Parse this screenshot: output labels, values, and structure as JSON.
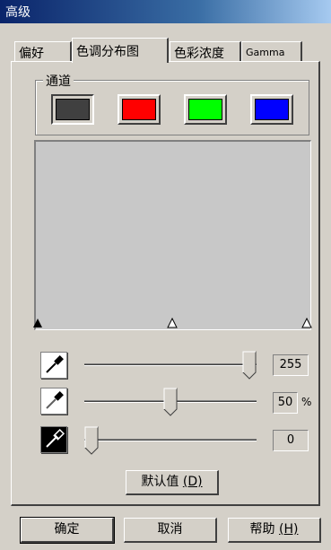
{
  "window": {
    "title": "高级"
  },
  "tabs": [
    {
      "label": "偏好"
    },
    {
      "label": "色调分布图",
      "active": true
    },
    {
      "label": "色彩浓度"
    },
    {
      "label": "Gamma"
    }
  ],
  "channel": {
    "group_label": "通道",
    "swatches": [
      {
        "name": "gray",
        "color": "#404040",
        "selected": true
      },
      {
        "name": "red",
        "color": "#ff0000"
      },
      {
        "name": "green",
        "color": "#00ff00"
      },
      {
        "name": "blue",
        "color": "#0000ff"
      }
    ]
  },
  "sliders": [
    {
      "name": "white-point",
      "value": "255",
      "unit": "",
      "level": 1.0
    },
    {
      "name": "gamma",
      "value": "50",
      "unit": "%",
      "level": 0.5
    },
    {
      "name": "black-point",
      "value": "0",
      "unit": "",
      "level": 0.0
    }
  ],
  "buttons": {
    "defaults": "默认值",
    "defaults_key": "(D)",
    "ok": "确定",
    "cancel": "取消",
    "help": "帮助",
    "help_key": "(H)"
  },
  "colors": {
    "titlebar": "#0a246a",
    "face": "#d4d0c8",
    "histogram_bg": "#c8c8c8"
  }
}
